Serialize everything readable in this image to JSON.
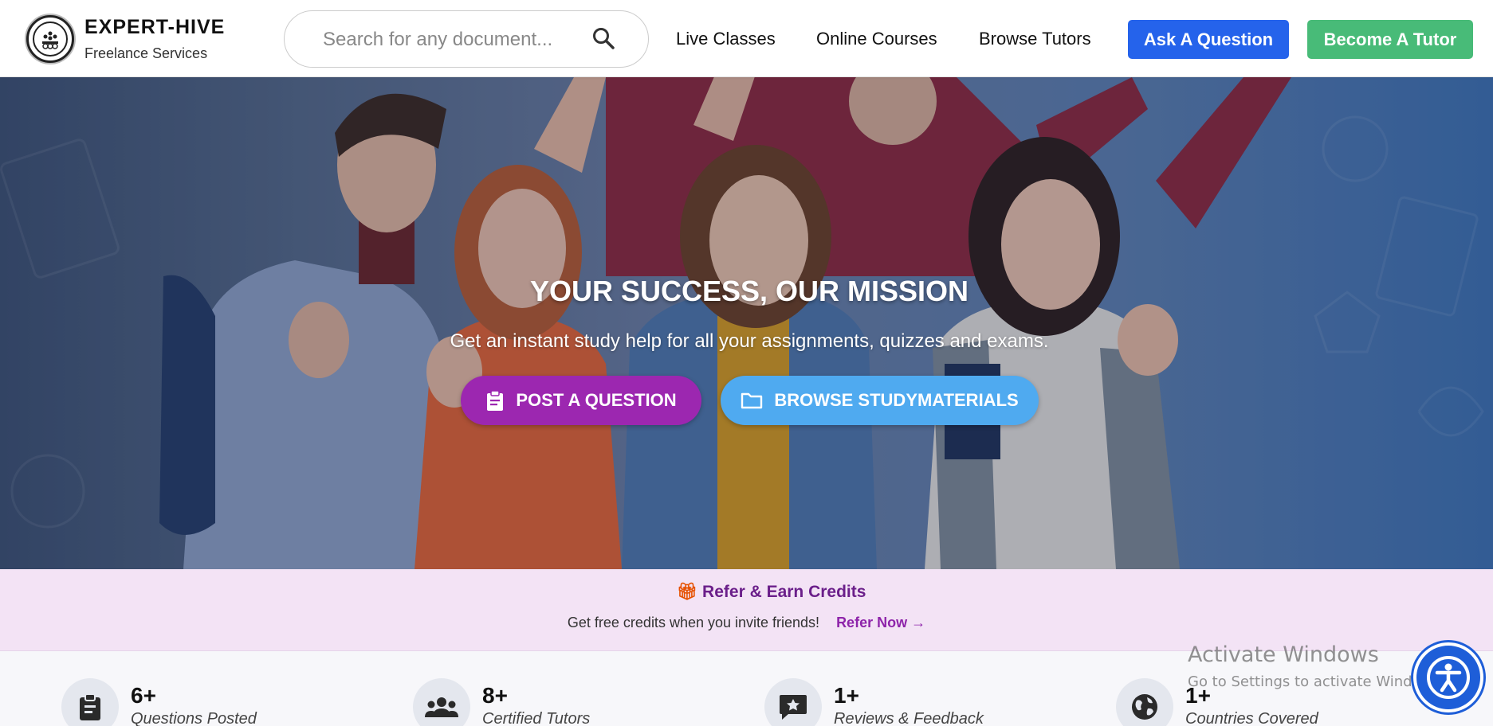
{
  "header": {
    "brand_title": "EXPERT-HIVE",
    "brand_subtitle": "Freelance Services",
    "search_placeholder": "Search for any document...",
    "nav": [
      "Live Classes",
      "Online Courses",
      "Browse Tutors"
    ],
    "ask_button": "Ask A Question",
    "tutor_button": "Become A Tutor"
  },
  "hero": {
    "title": "YOUR SUCCESS, OUR MISSION",
    "subtitle": "Get an instant study help for all your assignments, quizzes and exams.",
    "post_button": "POST A QUESTION",
    "browse_button": "BROWSE STUDYMATERIALS"
  },
  "refer": {
    "title": "Refer & Earn Credits",
    "text": "Get free credits when you invite friends!",
    "link": "Refer Now →"
  },
  "stats": [
    {
      "value": "6+",
      "label": "Questions Posted",
      "icon": "clipboard-icon"
    },
    {
      "value": "8+",
      "label": "Certified Tutors",
      "icon": "users-icon"
    },
    {
      "value": "1+",
      "label": "Reviews & Feedback",
      "icon": "comment-star-icon"
    },
    {
      "value": "1+",
      "label": "Countries Covered",
      "icon": "globe-icon"
    }
  ],
  "watermark": {
    "title": "Activate Windows",
    "subtitle": "Go to Settings to activate Windows."
  },
  "colors": {
    "ask": "#2563eb",
    "tutor": "#48bb78",
    "post": "#9c27b0",
    "browse": "#4faaf0",
    "refer_bg": "#f3e3f5"
  }
}
